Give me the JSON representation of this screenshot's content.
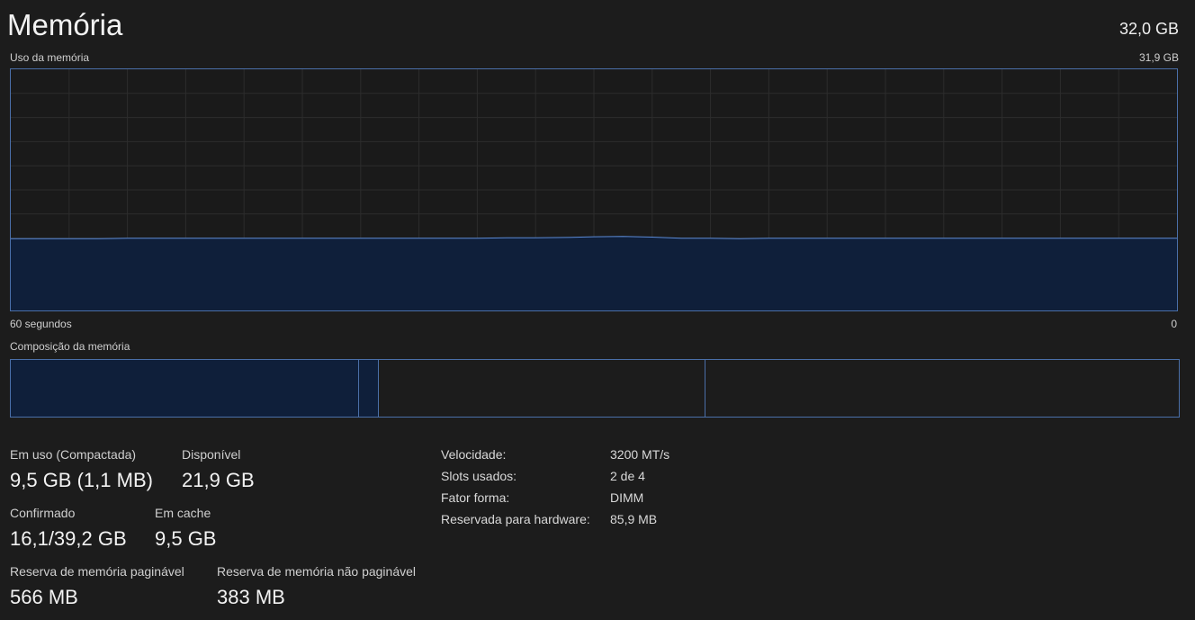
{
  "header": {
    "title": "Memória",
    "total": "32,0 GB"
  },
  "usage_graph": {
    "label": "Uso da memória",
    "max_label": "31,9 GB",
    "time_left": "60 segundos",
    "time_right": "0",
    "line_color": "#5b8ad6",
    "fill_color": "#0f1f3a",
    "max_gb": 31.9,
    "series_gb": [
      9.5,
      9.5,
      9.5,
      9.5,
      9.55,
      9.55,
      9.55,
      9.55,
      9.55,
      9.55,
      9.55,
      9.55,
      9.55,
      9.55,
      9.55,
      9.55,
      9.55,
      9.6,
      9.6,
      9.65,
      9.75,
      9.8,
      9.7,
      9.55,
      9.55,
      9.5,
      9.55,
      9.55,
      9.55,
      9.55,
      9.55,
      9.55,
      9.55,
      9.55,
      9.55,
      9.55,
      9.55,
      9.55,
      9.55,
      9.55,
      9.55
    ]
  },
  "composition": {
    "label": "Composição da memória",
    "segments": [
      {
        "name": "in-use",
        "fraction": 0.298,
        "fill": "#0f1f3a"
      },
      {
        "name": "modified",
        "fraction": 0.017,
        "fill": "#0f1f3a"
      },
      {
        "name": "standby",
        "fraction": 0.28,
        "fill": "#1c1c1c"
      },
      {
        "name": "free",
        "fraction": 0.405,
        "fill": "#1c1c1c"
      }
    ]
  },
  "stats": {
    "in_use": {
      "label": "Em uso (Compactada)",
      "value": "9,5 GB (1,1 MB)"
    },
    "available": {
      "label": "Disponível",
      "value": "21,9 GB"
    },
    "committed": {
      "label": "Confirmado",
      "value": "16,1/39,2 GB"
    },
    "cached": {
      "label": "Em cache",
      "value": "9,5 GB"
    },
    "paged_pool": {
      "label": "Reserva de memória paginável",
      "value": "566 MB"
    },
    "nonpaged_pool": {
      "label": "Reserva de memória não paginável",
      "value": "383 MB"
    }
  },
  "info": [
    {
      "key": "Velocidade:",
      "value": "3200 MT/s"
    },
    {
      "key": "Slots usados:",
      "value": "2 de 4"
    },
    {
      "key": "Fator forma:",
      "value": "DIMM"
    },
    {
      "key": "Reservada para hardware:",
      "value": "85,9 MB"
    }
  ]
}
